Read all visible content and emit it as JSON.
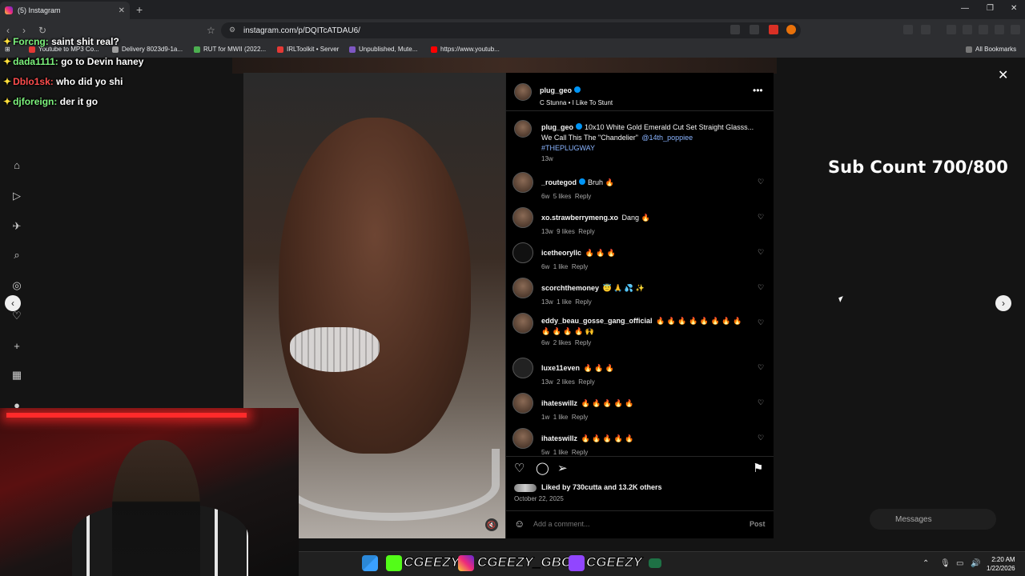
{
  "browser": {
    "tab_title": "(5) Instagram",
    "url": "instagram.com/p/DQITcATDAU6/",
    "bookmarks": [
      "Youtube to MP3 Co...",
      "Delivery 8023d9-1a...",
      "RUT for MWII (2022...",
      "IRLToolkit • Server",
      "Unpublished, Mute...",
      "https://www.youtub..."
    ],
    "all_bookmarks": "All Bookmarks"
  },
  "chat": [
    {
      "user": "Forcng:",
      "text": "saint shit real?"
    },
    {
      "user": "dada1111:",
      "text": "go to Devin haney"
    },
    {
      "user": "Dblo1sk:",
      "text": "who did yo shi"
    },
    {
      "user": "djforeign:",
      "text": "der it go"
    }
  ],
  "post": {
    "author": "plug_geo",
    "audio": "C Stunna • I Like To Stunt",
    "caption_user": "plug_geo",
    "caption_text": "10x10 White Gold Emerald Cut Set Straight Glasss...",
    "caption_line2": "We Call This The \"Chandelier\"",
    "caption_mention": "@14th_poppiee",
    "caption_tag": "#THEPLUGWAY",
    "caption_time": "13w",
    "comments": [
      {
        "user": "_routegod",
        "text": "Bruh 🔥",
        "time": "6w",
        "likes": "5 likes",
        "reply": "Reply"
      },
      {
        "user": "xo.strawberrymeng.xo",
        "text": "Dang 🔥",
        "time": "13w",
        "likes": "9 likes",
        "reply": "Reply"
      },
      {
        "user": "icetheoryllc",
        "text": "🔥 🔥 🔥",
        "time": "6w",
        "likes": "1 like",
        "reply": "Reply"
      },
      {
        "user": "scorchthemoney",
        "text": "😇 🙏 💦 ✨",
        "time": "13w",
        "likes": "1 like",
        "reply": "Reply"
      },
      {
        "user": "eddy_beau_gosse_gang_official",
        "text": "🔥 🔥 🔥 🔥 🔥 🔥 🔥 🔥 🔥 🔥 🔥 🔥 🙌",
        "time": "6w",
        "likes": "2 likes",
        "reply": "Reply"
      },
      {
        "user": "luxe11even",
        "text": "🔥 🔥 🔥",
        "time": "13w",
        "likes": "2 likes",
        "reply": "Reply"
      },
      {
        "user": "ihateswillz",
        "text": "🔥 🔥 🔥 🔥 🔥",
        "time": "1w",
        "likes": "1 like",
        "reply": "Reply"
      },
      {
        "user": "ihateswillz",
        "text": "🔥 🔥 🔥 🔥 🔥",
        "time": "5w",
        "likes": "1 like",
        "reply": "Reply"
      }
    ],
    "liked_by": "Liked by 730cutta and 13.2K others",
    "date": "October 22, 2025",
    "add_comment_placeholder": "Add a comment...",
    "post_button": "Post"
  },
  "overlay": {
    "sub_count": "Sub Count 700/800",
    "messages": "Messages"
  },
  "taskbar": {
    "names": [
      "CGEEZY",
      "CGEEZY_GBC",
      "CGEEZY"
    ],
    "time": "2:20 AM",
    "date": "1/22/2026"
  }
}
